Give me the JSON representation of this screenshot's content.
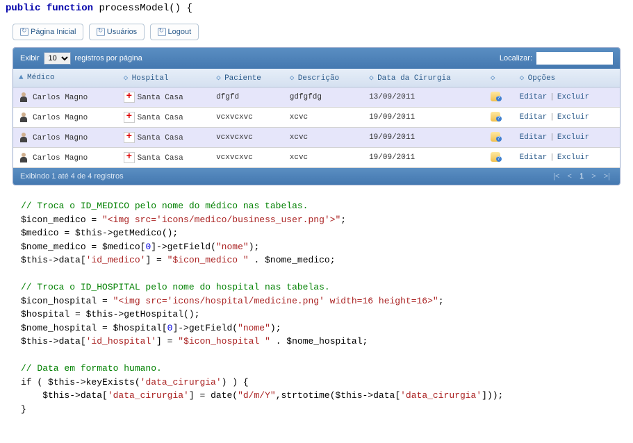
{
  "code_header": {
    "public": "public",
    "function": "function",
    "name": "processModel",
    "paren": "()",
    "brace": "{"
  },
  "buttons": {
    "home": "Página Inicial",
    "users": "Usuários",
    "logout": "Logout"
  },
  "table": {
    "show_label": "Exibir",
    "per_page_value": "10",
    "per_page_suffix": "registros por página",
    "search_label": "Localizar:",
    "search_value": "",
    "headers": {
      "medico": "Médico",
      "hospital": "Hospital",
      "paciente": "Paciente",
      "descricao": "Descrição",
      "data": "Data da Cirurgia",
      "opcoes": "Opções"
    },
    "rows": [
      {
        "medico": "Carlos Magno",
        "hospital": "Santa Casa",
        "paciente": "dfgfd",
        "descricao": "gdfgfdg",
        "data": "13/09/2011"
      },
      {
        "medico": "Carlos Magno",
        "hospital": "Santa Casa",
        "paciente": "vcxvcxvc",
        "descricao": "xcvc",
        "data": "19/09/2011"
      },
      {
        "medico": "Carlos Magno",
        "hospital": "Santa Casa",
        "paciente": "vcxvcxvc",
        "descricao": "xcvc",
        "data": "19/09/2011"
      },
      {
        "medico": "Carlos Magno",
        "hospital": "Santa Casa",
        "paciente": "vcxvcxvc",
        "descricao": "xcvc",
        "data": "19/09/2011"
      }
    ],
    "actions": {
      "edit": "Editar",
      "delete": "Excluir"
    },
    "footer_info": "Exibindo 1 até 4 de 4 registros",
    "pager": {
      "first": "|<",
      "prev": "<",
      "current": "1",
      "next": ">",
      "last": ">|"
    }
  },
  "code": {
    "l1": "// Troca o ID_MEDICO pelo nome do médico nas tabelas.",
    "l2a": "$icon_medico = ",
    "l2b": "\"<img src='icons/medico/business_user.png'>\"",
    "l2c": ";",
    "l3": "$medico = $this->getMedico();",
    "l4a": "$nome_medico = $medico[",
    "l4n": "0",
    "l4b": "]->getField(",
    "l4s": "\"nome\"",
    "l4c": ");",
    "l5a": "$this->data[",
    "l5s1": "'id_medico'",
    "l5b": "] = ",
    "l5s2": "\"$icon_medico \"",
    "l5c": " . $nome_medico;",
    "l7": "// Troca o ID_HOSPITAL pelo nome do hospital nas tabelas.",
    "l8a": "$icon_hospital = ",
    "l8b": "\"<img src='icons/hospital/medicine.png' width=16 height=16>\"",
    "l8c": ";",
    "l9": "$hospital = $this->getHospital();",
    "l10a": "$nome_hospital = $hospital[",
    "l10n": "0",
    "l10b": "]->getField(",
    "l10s": "\"nome\"",
    "l10c": ");",
    "l11a": "$this->data[",
    "l11s1": "'id_hospital'",
    "l11b": "] = ",
    "l11s2": "\"$icon_hospital \"",
    "l11c": " . $nome_hospital;",
    "l13": "// Data em formato humano.",
    "l14a": "if ( $this->keyExists(",
    "l14s": "'data_cirurgia'",
    "l14b": ") ) {",
    "l15a": "    $this->data[",
    "l15s1": "'data_cirurgia'",
    "l15b": "] = date(",
    "l15s2": "\"d/m/Y\"",
    "l15c": ",strtotime($this->data[",
    "l15s3": "'data_cirurgia'",
    "l15d": "]));",
    "l16": "}"
  }
}
